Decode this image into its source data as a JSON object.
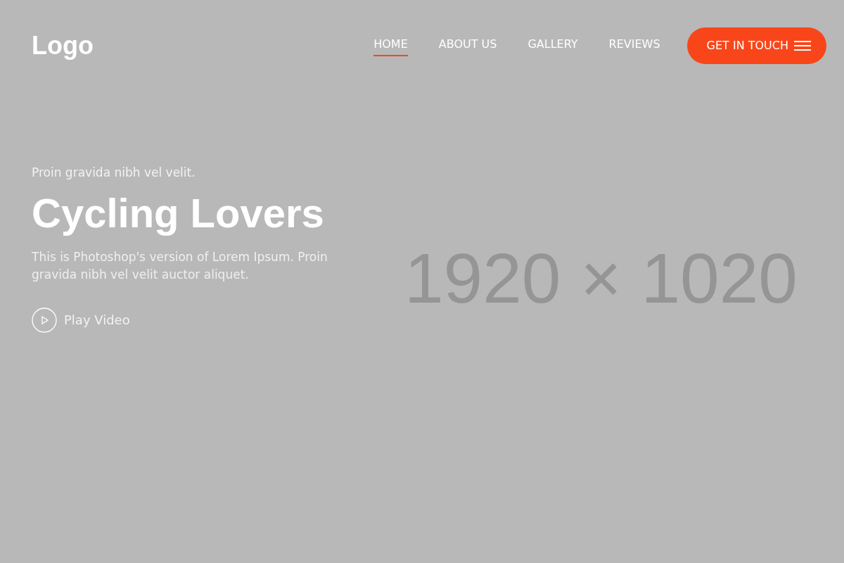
{
  "logo": "Logo",
  "nav": [
    {
      "label": "HOME",
      "selected": true
    },
    {
      "label": "ABOUT US",
      "selected": false
    },
    {
      "label": "GALLERY",
      "selected": false
    },
    {
      "label": "REVIEWS",
      "selected": false
    }
  ],
  "cta_button": "GET IN TOUCH",
  "hero": {
    "placeholder_label": "1920 × 1020",
    "kicker": "Proin gravida nibh vel velit.",
    "title": "Cycling Lovers",
    "description": "This is Photoshop's version of Lorem Ipsum. Proin gravida nibh vel velit auctor aliquet.",
    "play_link": "Play Video"
  }
}
